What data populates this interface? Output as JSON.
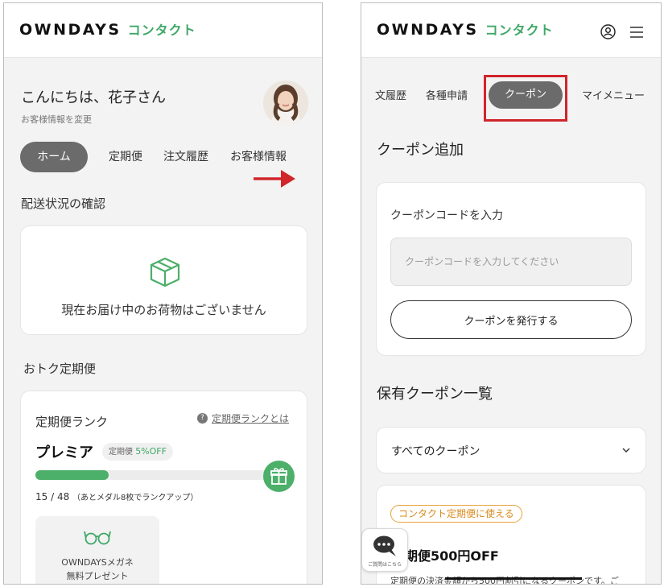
{
  "left_screen": {
    "brand": "OWNDAYS",
    "brand_sub": "コンタクト",
    "greeting": "こんにちは、花子さん",
    "edit_link": "お客様情報を変更",
    "tabs": [
      {
        "label": "ホーム",
        "active": true
      },
      {
        "label": "定期便",
        "active": false
      },
      {
        "label": "注文履歴",
        "active": false
      },
      {
        "label": "お客様情報",
        "active": false
      }
    ],
    "delivery_section_title": "配送状況の確認",
    "delivery_empty_text": "現在お届け中のお荷物はございません",
    "subscription_section_title": "おトク定期便",
    "rank_card": {
      "title": "定期便ランク",
      "help_link": "定期便ランクとは",
      "rank_name": "プレミア",
      "badge_prefix": "定期便 ",
      "badge_discount": "5%OFF",
      "progress_current": 15,
      "progress_total": 48,
      "progress_text": "15 / 48",
      "progress_note": "（あとメダル8枚でランクアップ）"
    },
    "reward": {
      "line1": "OWNDAYSメガネ",
      "line2": "無料プレゼント"
    }
  },
  "right_screen": {
    "brand": "OWNDAYS",
    "brand_sub": "コンタクト",
    "tabs": [
      {
        "label": "文履歴",
        "active": false
      },
      {
        "label": "各種申請",
        "active": false
      },
      {
        "label": "クーポン",
        "active": true
      },
      {
        "label": "マイメニュー",
        "active": false
      }
    ],
    "coupon_add_title": "クーポン追加",
    "coupon_code_label": "クーポンコードを入力",
    "coupon_code_placeholder": "クーポンコードを入力してください",
    "issue_button": "クーポンを発行する",
    "owned_coupons_title": "保有クーポン一覧",
    "filter_selected": "すべてのクーポン",
    "coupon_item": {
      "tag": "コンタクト定期便に使える",
      "title": "期便500円OFF",
      "description": "定期便の決済金額から500円割引になるクーポンです。ご"
    },
    "chat_label": "ご質問はこちら"
  },
  "colors": {
    "brand_green": "#3fa867",
    "active_tab": "#6b6b6b",
    "highlight_red": "#d0252a",
    "arrow_red": "#d0252a",
    "coupon_tag_orange": "#e8a13a"
  },
  "icons": [
    "arrow-right-icon",
    "box-icon",
    "question-icon",
    "gift-icon",
    "glasses-icon",
    "user-icon",
    "menu-icon",
    "chevron-down-icon",
    "chat-icon"
  ]
}
